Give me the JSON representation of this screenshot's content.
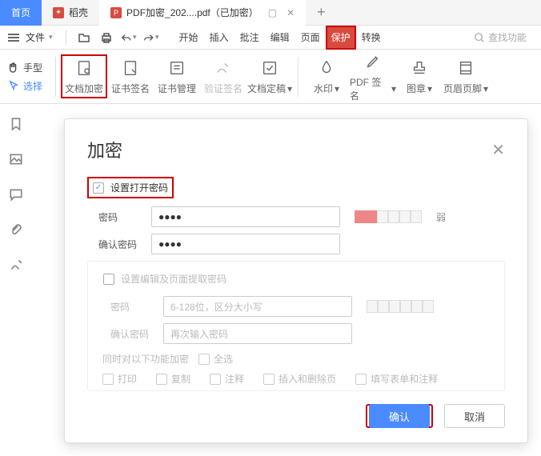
{
  "tabs": {
    "home": "首页",
    "docker": "稻壳",
    "doc": "PDF加密_202....pdf（已加密）"
  },
  "menubar": {
    "file": "文件"
  },
  "menutabs": [
    "开始",
    "插入",
    "批注",
    "编辑",
    "页面",
    "保护",
    "转换"
  ],
  "search_placeholder": "查找功能",
  "side_tools": {
    "hand": "手型",
    "select": "选择"
  },
  "ribbon": [
    {
      "label": "文档加密",
      "drop": false
    },
    {
      "label": "证书签名",
      "drop": false
    },
    {
      "label": "证书管理",
      "drop": false
    },
    {
      "label": "验证签名",
      "drop": false
    },
    {
      "label": "文档定稿",
      "drop": true
    },
    {
      "label": "水印",
      "drop": true
    },
    {
      "label": "PDF 签名",
      "drop": true
    },
    {
      "label": "图章",
      "drop": true
    },
    {
      "label": "页眉页脚",
      "drop": true
    }
  ],
  "dialog": {
    "title": "加密",
    "open_pw_chk": "设置打开密码",
    "pw_label": "密码",
    "pw_value": "●●●●",
    "confirm_label": "确认密码",
    "confirm_value": "●●●●",
    "strength_text": "弱",
    "edit_pw_chk": "设置编辑及页面提取密码",
    "pw2_placeholder": "6-128位，区分大小写",
    "confirm2_placeholder": "再次输入密码",
    "also_encrypt": "同时对以下功能加密",
    "select_all": "全选",
    "opts": [
      "打印",
      "复制",
      "注释",
      "插入和删除页",
      "填写表单和注释"
    ],
    "ok": "确认",
    "cancel": "取消"
  }
}
